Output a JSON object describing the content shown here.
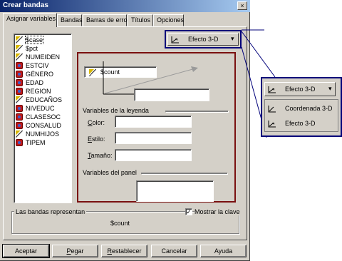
{
  "window": {
    "title": "Crear bandas",
    "close": "×"
  },
  "tabs": [
    {
      "label": "Asignar variables"
    },
    {
      "label": "Bandas"
    },
    {
      "label": "Barras de error"
    },
    {
      "label": "Títulos"
    },
    {
      "label": "Opciones"
    }
  ],
  "variables": [
    {
      "name": "$case",
      "type": "scale"
    },
    {
      "name": "$pct",
      "type": "scale"
    },
    {
      "name": "NUMEIDEN",
      "type": "scale"
    },
    {
      "name": "ESTCIV",
      "type": "nominal"
    },
    {
      "name": "GÉNERO",
      "type": "nominal"
    },
    {
      "name": "EDAD",
      "type": "nominal"
    },
    {
      "name": "REGION",
      "type": "nominal"
    },
    {
      "name": "EDUCAÑOS",
      "type": "scale"
    },
    {
      "name": "NIVEDUC",
      "type": "nominal"
    },
    {
      "name": "CLASESOC",
      "type": "nominal"
    },
    {
      "name": "CONSALUD",
      "type": "nominal"
    },
    {
      "name": "NUMHIJOS",
      "type": "scale"
    },
    {
      "name": "TIPEM",
      "type": "nominal"
    }
  ],
  "chart_type_dropdown": {
    "value": "Efecto 3-D",
    "arrow": "▾"
  },
  "chart": {
    "y_variable": "$count"
  },
  "legend": {
    "title": "Variables de la leyenda",
    "color_label_u": "C",
    "color_label_rest": "olor:",
    "style_label_u": "E",
    "style_label_rest": "stilo:",
    "size_label_u": "T",
    "size_label_rest": "amaño:"
  },
  "panel_vars": {
    "title": "Variables del panel"
  },
  "bands": {
    "label": "Las bandas representan",
    "value": "$count"
  },
  "show_key": {
    "label": "Mostrar la clave",
    "checked": "✓"
  },
  "buttons": [
    {
      "label": "Aceptar",
      "underline": "",
      "rest": "Aceptar"
    },
    {
      "label": "Pegar",
      "underline": "P",
      "rest": "egar"
    },
    {
      "label": "Restablecer",
      "underline": "R",
      "rest": "establecer"
    },
    {
      "label": "Cancelar",
      "underline": "",
      "rest": "Cancelar"
    },
    {
      "label": "Ayuda",
      "underline": "",
      "rest": "Ayuda"
    }
  ],
  "callout": {
    "dropdown_value": "Efecto 3-D",
    "options": [
      "Coordenada 3-D",
      "Efecto 3-D"
    ]
  }
}
